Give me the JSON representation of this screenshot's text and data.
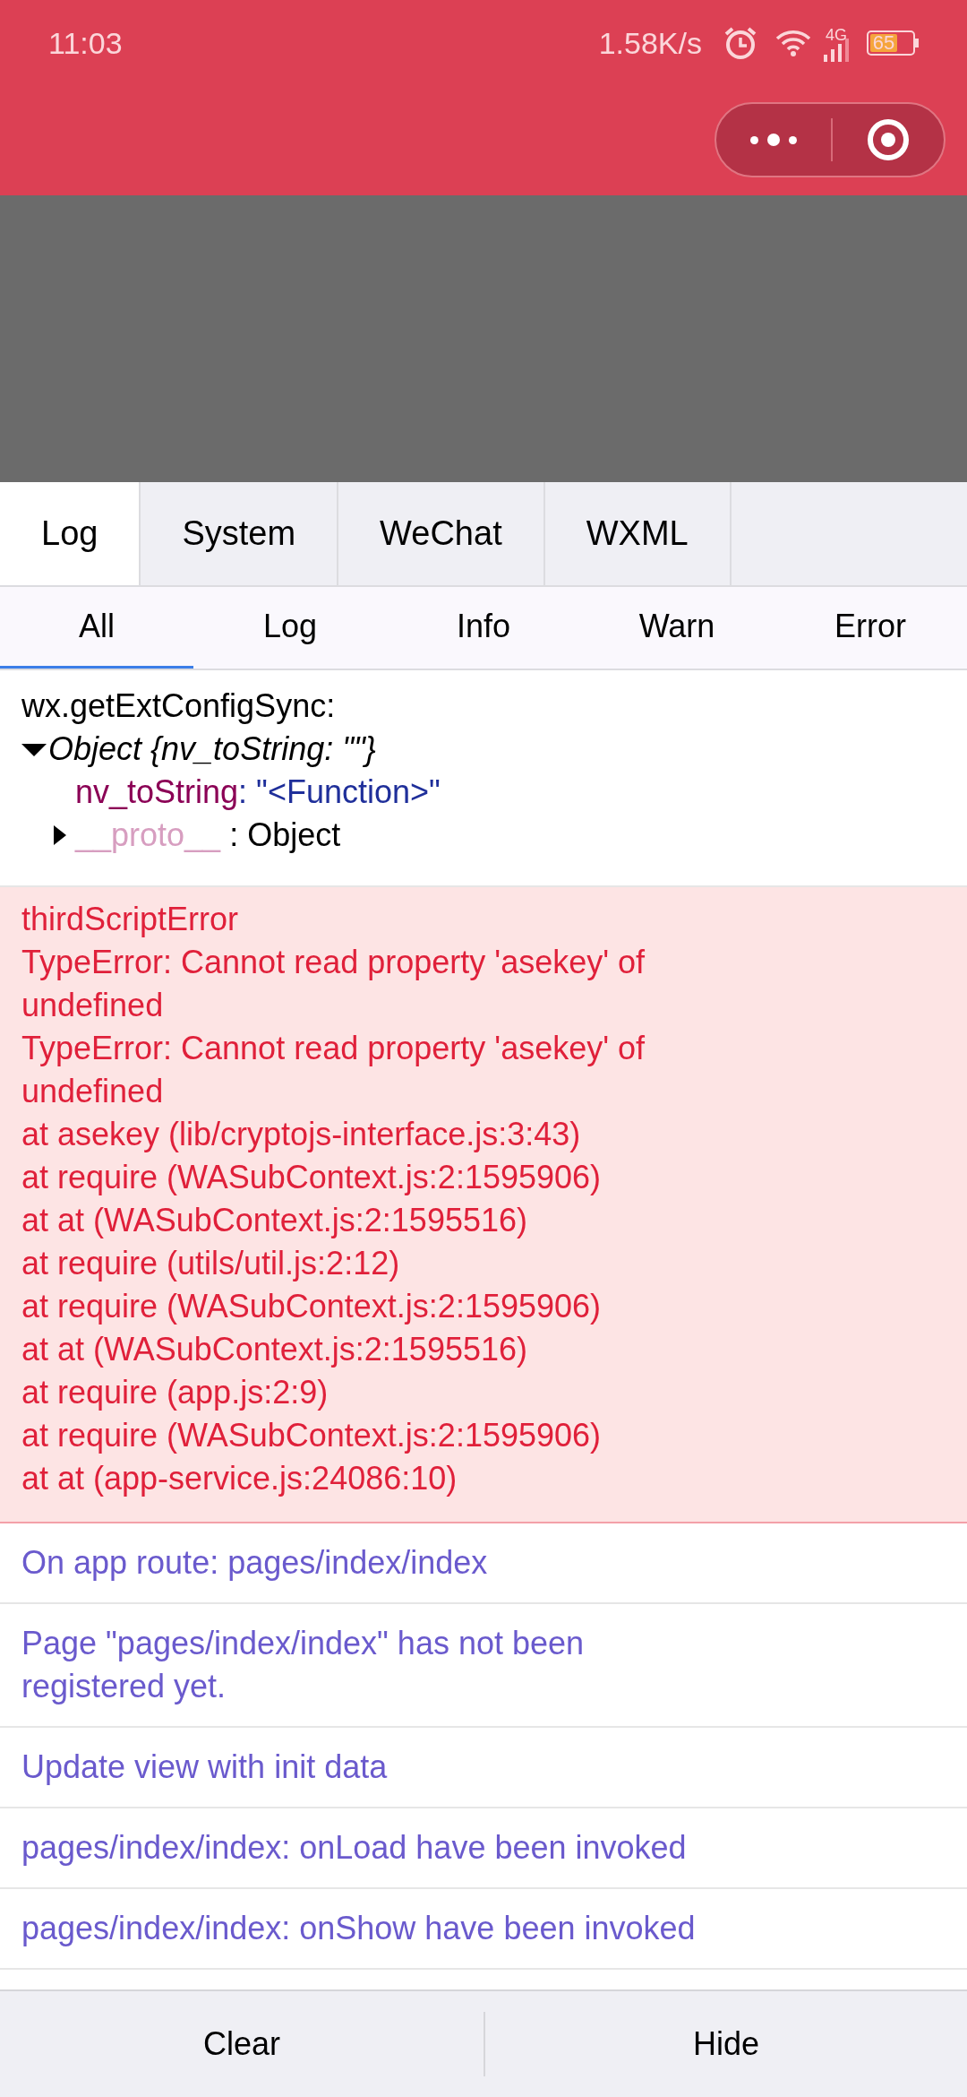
{
  "status_bar": {
    "time": "11:03",
    "speed": "1.58K/s",
    "network": "4G",
    "battery": "65"
  },
  "tabs": [
    {
      "label": "Log",
      "selected": true
    },
    {
      "label": "System",
      "selected": false
    },
    {
      "label": "WeChat",
      "selected": false
    },
    {
      "label": "WXML",
      "selected": false
    }
  ],
  "filters": [
    {
      "label": "All",
      "selected": true
    },
    {
      "label": "Log",
      "selected": false
    },
    {
      "label": "Info",
      "selected": false
    },
    {
      "label": "Warn",
      "selected": false
    },
    {
      "label": "Error",
      "selected": false
    }
  ],
  "entries": [
    {
      "kind": "object",
      "title": "wx.getExtConfigSync:",
      "summary": "Object {nv_toString: \"\"}",
      "expanded": true,
      "prop_key": "nv_toString",
      "prop_value": ": \"<Function>\"",
      "proto_key": "__proto__",
      "proto_value": ": Object"
    },
    {
      "kind": "error",
      "lines": [
        "thirdScriptError",
        "TypeError: Cannot read property 'asekey' of undefined",
        "TypeError: Cannot read property 'asekey' of undefined",
        "at asekey (lib/cryptojs-interface.js:3:43)",
        "at require (WASubContext.js:2:1595906)",
        "at at (WASubContext.js:2:1595516)",
        "at require (utils/util.js:2:12)",
        "at require (WASubContext.js:2:1595906)",
        "at at (WASubContext.js:2:1595516)",
        "at require (app.js:2:9)",
        "at require (WASubContext.js:2:1595906)",
        "at at (app-service.js:24086:10)"
      ]
    },
    {
      "kind": "info",
      "text": "On app route: pages/index/index"
    },
    {
      "kind": "info",
      "text": "Page \"pages/index/index\" has not been registered yet."
    },
    {
      "kind": "info",
      "text": "Update view with init data"
    },
    {
      "kind": "info",
      "text": "pages/index/index: onLoad have been invoked"
    },
    {
      "kind": "info",
      "text": "pages/index/index: onShow have been invoked"
    }
  ],
  "buttons": [
    "Clear",
    "Hide"
  ]
}
